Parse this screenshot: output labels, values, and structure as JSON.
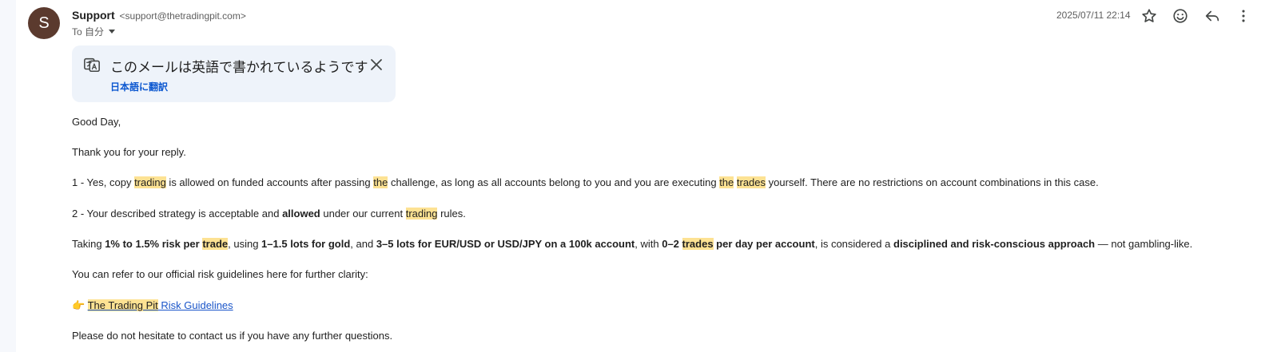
{
  "header": {
    "avatar_letter": "S",
    "sender_name": "Support",
    "sender_email": "<support@thetradingpit.com>",
    "to_label": "To 自分",
    "datetime": "2025/07/11 22:14",
    "icons": [
      "star-icon",
      "emoji-icon",
      "reply-icon",
      "more-vert-icon"
    ]
  },
  "translate_banner": {
    "title": "このメールは英語で書かれているようです",
    "link": "日本語に翻訳",
    "icons": [
      "translate-icon",
      "close-icon"
    ]
  },
  "body": {
    "greeting": "Good Day,",
    "thanks": "Thank you for your reply.",
    "point1": {
      "a": "1 - Yes, copy ",
      "b": "trading",
      "c": " is allowed on funded accounts after passing ",
      "d": "the",
      "e": " challenge, as long as all accounts belong to you and you are executing ",
      "f": "the",
      "g": " ",
      "h": "trades",
      "i": " yourself. There are no restrictions on account combinations in this case."
    },
    "point2": {
      "a": "2 - Your described strategy is acceptable and ",
      "b": "allowed",
      "c": " under our current ",
      "d": "trading",
      "e": " rules."
    },
    "taking": {
      "a": "Taking ",
      "b": "1% to 1.5% risk per ",
      "c": "trade",
      "d": ", using ",
      "e": "1–1.5 lots for gold",
      "f": ", and ",
      "g": "3–5 lots for EUR/USD or USD/JPY on a 100k account",
      "h": ", with ",
      "i": "0–2 ",
      "j": "trades",
      "k": " per day per account",
      "l": ", is considered a ",
      "m": "disciplined and risk-conscious approach",
      "n": " — not gambling-like."
    },
    "refer": "You can refer to our official risk guidelines here for further clarity:",
    "link": {
      "emoji": "👉 ",
      "part1": "The Trading Pit",
      "part2": " Risk Guidelines"
    },
    "closing": "Please do not hesitate to contact us if you have any further questions."
  },
  "colors": {
    "avatar_bg": "#5b3a2e",
    "highlight": "#fde293",
    "link": "#1a55c9",
    "banner_bg": "#eef3fa",
    "translate_link": "#0b57d0"
  }
}
